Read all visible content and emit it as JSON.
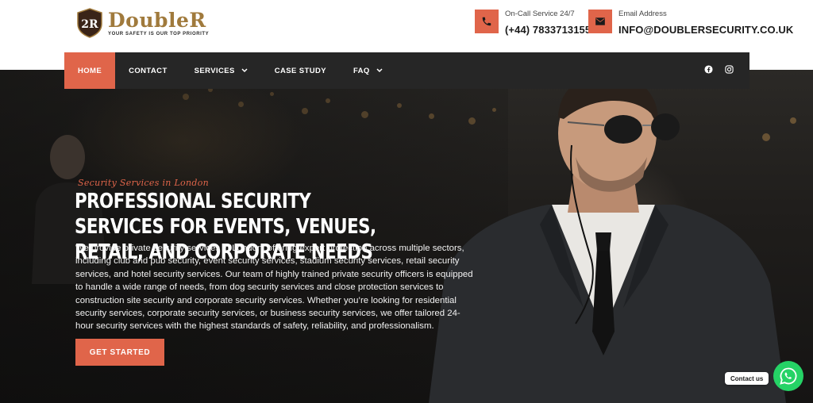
{
  "brand": {
    "name": "DoubleR",
    "tagline": "YOUR SAFETY IS OUR TOP PRIORITY",
    "badge_initials": "2R",
    "color_gold": "#a07a3c"
  },
  "header": {
    "phone": {
      "label": "On-Call Service 24/7",
      "value": "(+44) 7833713155",
      "icon": "phone-icon"
    },
    "email": {
      "label": "Email Address",
      "value": "INFO@DOUBLERSECURITY.CO.UK",
      "icon": "envelope-icon"
    }
  },
  "nav": {
    "items": [
      {
        "label": "HOME",
        "active": true,
        "has_dropdown": false
      },
      {
        "label": "CONTACT",
        "active": false,
        "has_dropdown": false
      },
      {
        "label": "SERVICES",
        "active": false,
        "has_dropdown": true
      },
      {
        "label": "CASE STUDY",
        "active": false,
        "has_dropdown": false
      },
      {
        "label": "FAQ",
        "active": false,
        "has_dropdown": true
      }
    ],
    "social": [
      "facebook-icon",
      "instagram-icon"
    ]
  },
  "hero": {
    "eyebrow": "Security Services in London",
    "headline": "PROFESSIONAL SECURITY SERVICES FOR EVENTS, VENUES, RETAIL, AND CORPORATE NEEDS",
    "description": "We provide private security services in London, offering expert protection across multiple sectors, including club and pub security, event security services, stadium security services, retail security services, and hotel security services. Our team of highly trained private security officers is equipped to handle a wide range of needs, from dog security services and close protection services to construction site security and corporate security services. Whether you’re looking for residential security services, corporate security services, or business security services, we offer tailored 24-hour security services with the highest standards of safety, reliability, and professionalism.",
    "cta_label": "GET STARTED"
  },
  "chat": {
    "label": "Contact us",
    "icon": "whatsapp-icon"
  },
  "colors": {
    "accent": "#e0654a",
    "nav_bg": "#262626",
    "whatsapp": "#25d366"
  }
}
